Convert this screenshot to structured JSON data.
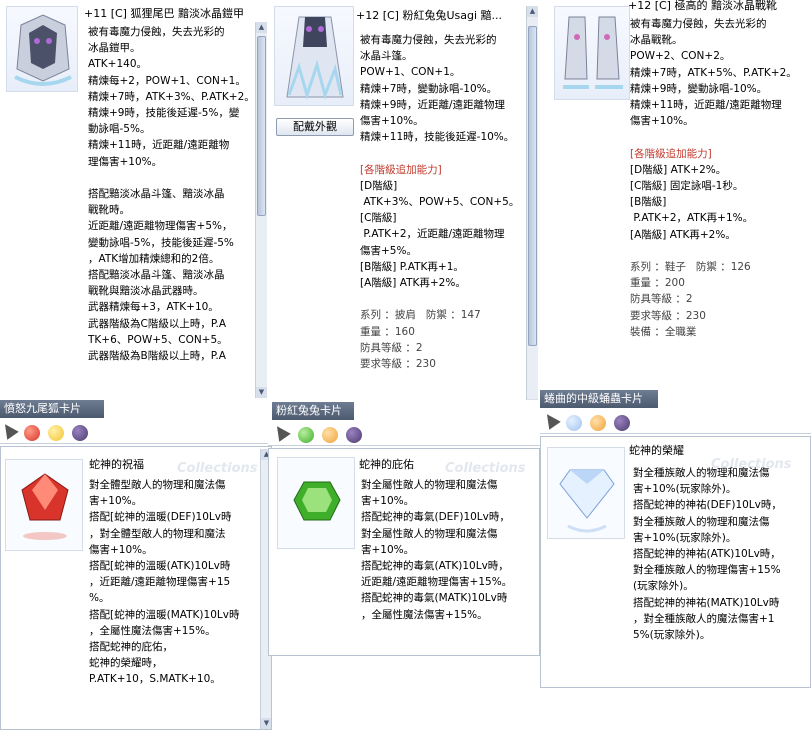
{
  "panel1": {
    "title": "+11 [C] 狐狸尾巴 黯淡冰晶鎧甲",
    "lines": [
      "被有毒魔力侵蝕，失去光彩的",
      "冰晶鎧甲。",
      "ATK+140。",
      "精煉每+2，POW+1、CON+1。",
      "精煉+7時，ATK+3%、P.ATK+2。",
      "精煉+9時，技能後延遲-5%，變",
      "動詠唱-5%。",
      "精煉+11時，近距離/遠距離物",
      "理傷害+10%。",
      "",
      "搭配黯淡冰晶斗篷、黯淡冰晶",
      "戰靴時。",
      "近距離/遠距離物理傷害+5%，",
      "變動詠唱-5%，技能後延遲-5%",
      "，ATK增加精煉總和的2倍。",
      "搭配黯淡冰晶斗篷、黯淡冰晶",
      "戰靴與黯淡冰晶武器時。",
      "武器精煉每+3，ATK+10。",
      "武器階級為C階級以上時，P.A",
      "TK+6、POW+5、CON+5。",
      "武器階級為B階級以上時，P.A"
    ],
    "card_bar": "憤怒九尾狐卡片",
    "card_title": "蛇神的祝福",
    "collections": "Collections",
    "card_lines": [
      "對全體型敵人的物理和魔法傷",
      "害+10%。",
      "搭配[蛇神的溫暖(DEF)10Lv時",
      "，對全體型敵人的物理和魔法",
      "傷害+10%。",
      "搭配[蛇神的溫暖(ATK)10Lv時",
      "，近距離/遠距離物理傷害+15",
      "%。",
      "搭配[蛇神的溫暖(MATK)10Lv時",
      "，全屬性魔法傷害+15%。",
      "搭配蛇神的庇佑，",
      "蛇神的榮耀時，",
      "P.ATK+10，S.MATK+10。"
    ]
  },
  "panel2": {
    "title": "+12 [C] 粉紅兔兔Usagi 黯...",
    "button": "配戴外觀",
    "lines": [
      "被有毒魔力侵蝕，失去光彩的",
      "冰晶斗篷。",
      "POW+1、CON+1。",
      "精煉+7時，變動詠唱-10%。",
      "精煉+9時，近距離/遠距離物理",
      "傷害+10%。",
      "精煉+11時，技能後延遲-10%。",
      "",
      "[各階級追加能力]",
      "[D階級]",
      " ATK+3%、POW+5、CON+5。",
      "[C階級]",
      " P.ATK+2，近距離/遠距離物理",
      "傷害+5%。",
      "[B階級] P.ATK再+1。",
      "[A階級] ATK再+2%。",
      "",
      "系列 ：披肩   防禦 ：147",
      "重量 ：160",
      "防具等級 ：2",
      "要求等級 ：230"
    ],
    "card_bar": "粉紅兔兔卡片",
    "card_title": "蛇神的庇佑",
    "collections": "Collections",
    "card_lines": [
      "對全屬性敵人的物理和魔法傷",
      "害+10%。",
      "搭配蛇神的毒氣(DEF)10Lv時，",
      "對全屬性敵人的物理和魔法傷",
      "害+10%。",
      "搭配蛇神的毒氣(ATK)10Lv時，",
      "近距離/遠距離物理傷害+15%。",
      "搭配蛇神的毒氣(MATK)10Lv時",
      "，全屬性魔法傷害+15%。"
    ]
  },
  "panel3": {
    "title": "+12 [C] 極高的 黯淡冰晶戰靴",
    "lines": [
      "被有毒魔力侵蝕，失去光彩的",
      "冰晶戰靴。",
      "POW+2、CON+2。",
      "精煉+7時，ATK+5%、P.ATK+2。",
      "精煉+9時，變動詠唱-10%。",
      "精煉+11時，近距離/遠距離物理",
      "傷害+10%。",
      "",
      "[各階級追加能力]",
      "[D階級] ATK+2%。",
      "[C階級] 固定詠唱-1秒。",
      "[B階級]",
      " P.ATK+2，ATK再+1%。",
      "[A階級] ATK再+2%。",
      "",
      "系列 ：鞋子   防禦 ：126",
      "重量 ：200",
      "防具等級 ：2",
      "要求等級 ：230",
      "裝備 ：全職業"
    ],
    "card_bar": "蜷曲的中級蛹蟲卡片",
    "card_title": "蛇神的榮耀",
    "collections": "Collections",
    "card_lines": [
      "對全種族敵人的物理和魔法傷",
      "害+10%(玩家除外)。",
      "搭配蛇神的神祐(DEF)10Lv時，",
      "對全種族敵人的物理和魔法傷",
      "害+10%(玩家除外)。",
      "搭配蛇神的神祐(ATK)10Lv時，",
      "對全種族敵人的物理傷害+15%",
      "(玩家除外)。",
      "搭配蛇神的神祐(MATK)10Lv時",
      "，對全種族敵人的魔法傷害+1",
      "5%(玩家除外)。"
    ]
  },
  "colors": {
    "gem_red": "#d8342b",
    "gem_green": "#3fae2a",
    "gem_blue": "#9fc3ef",
    "gem_orange": "#f0a23a",
    "gem_purple": "#4b3b6a",
    "gem_yellow": "#f2c531"
  }
}
